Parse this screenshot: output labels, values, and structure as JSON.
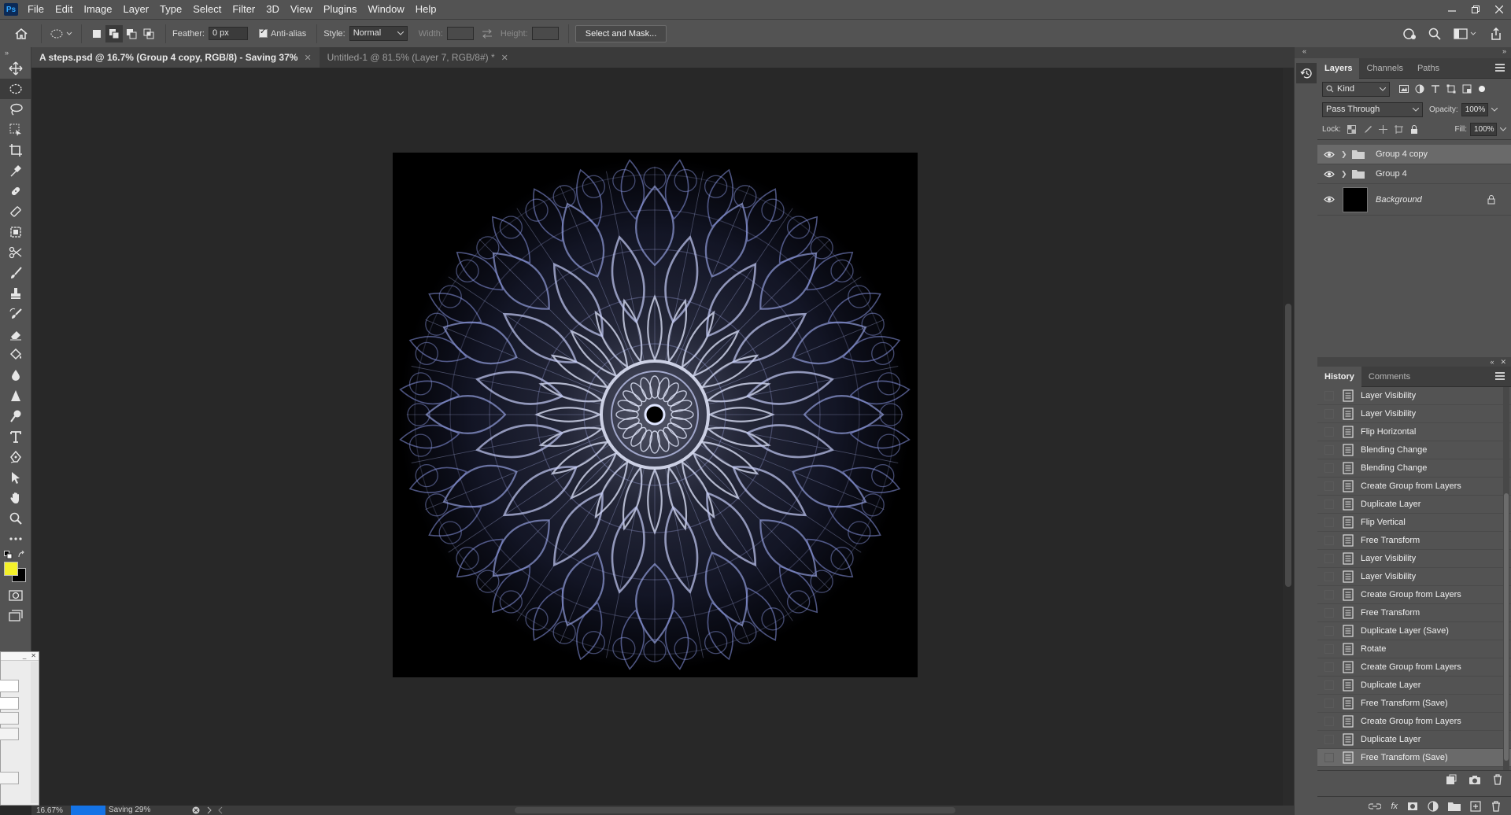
{
  "app": {
    "logo_text": "Ps"
  },
  "menubar": {
    "items": [
      "File",
      "Edit",
      "Image",
      "Layer",
      "Type",
      "Select",
      "Filter",
      "3D",
      "View",
      "Plugins",
      "Window",
      "Help"
    ]
  },
  "options": {
    "feather_label": "Feather:",
    "feather_value": "0 px",
    "anti_alias_label": "Anti-alias",
    "style_label": "Style:",
    "style_value": "Normal",
    "width_label": "Width:",
    "height_label": "Height:",
    "select_mask_label": "Select and Mask..."
  },
  "tabs": [
    {
      "title": "A steps.psd @ 16.7% (Group 4 copy, RGB/8) - Saving 37%",
      "active": true
    },
    {
      "title": "Untitled-1 @ 81.5% (Layer 7, RGB/8#) *",
      "active": false
    }
  ],
  "colors": {
    "foreground": "#f4f12a",
    "background": "#000000",
    "progress": "#1473e6"
  },
  "status": {
    "zoom": "16.67%",
    "progress_label": "Saving 29%",
    "progress_fraction": 0.29
  },
  "layers_panel": {
    "tabs": [
      "Layers",
      "Channels",
      "Paths"
    ],
    "filter_value": "Kind",
    "blend_mode": "Pass Through",
    "opacity_label": "Opacity:",
    "opacity_value": "100%",
    "lock_label": "Lock:",
    "fill_label": "Fill:",
    "fill_value": "100%",
    "layers": [
      {
        "name": "Group 4 copy",
        "type": "group",
        "selected": true
      },
      {
        "name": "Group 4",
        "type": "group",
        "selected": false
      },
      {
        "name": "Background",
        "type": "pixel",
        "selected": false,
        "locked": true
      }
    ]
  },
  "history_panel": {
    "tabs": [
      "History",
      "Comments"
    ],
    "items": [
      "Layer Visibility",
      "Layer Visibility",
      "Flip Horizontal",
      "Blending Change",
      "Blending Change",
      "Create Group from Layers",
      "Duplicate Layer",
      "Flip Vertical",
      "Free Transform",
      "Layer Visibility",
      "Layer Visibility",
      "Create Group from Layers",
      "Free Transform",
      "Duplicate Layer (Save)",
      "Rotate",
      "Create Group from Layers",
      "Duplicate Layer",
      "Free Transform (Save)",
      "Create Group from Layers",
      "Duplicate Layer",
      "Free Transform (Save)"
    ],
    "current_index": 20
  }
}
